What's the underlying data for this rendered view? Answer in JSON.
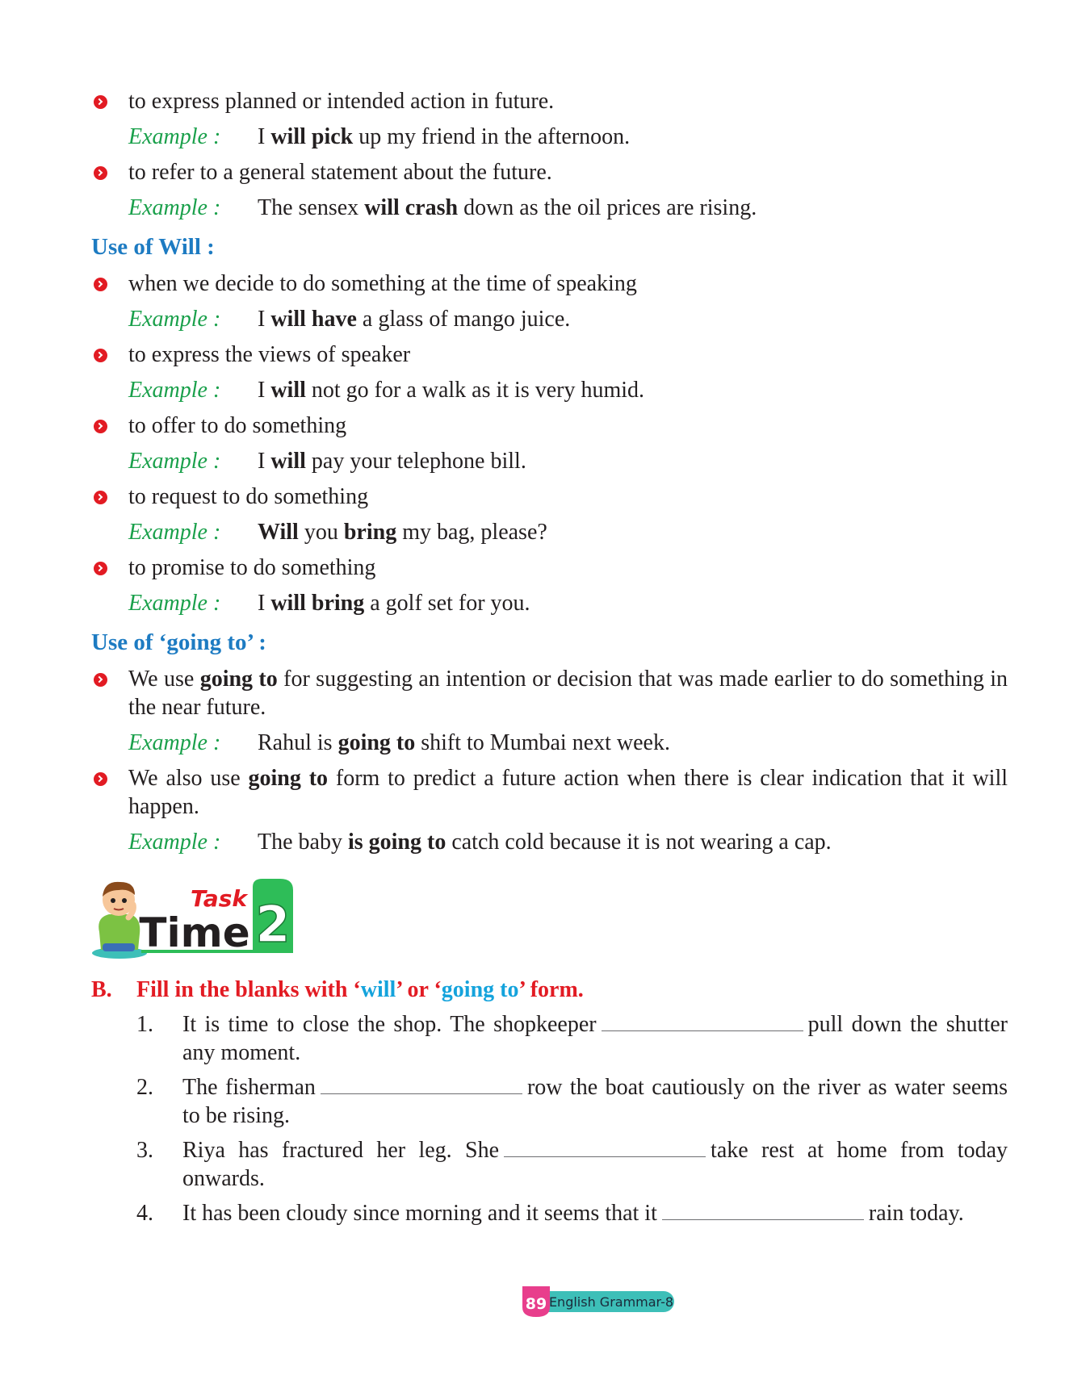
{
  "bullets_intro": [
    {
      "text": "to express planned or intended action in future.",
      "example": {
        "pre": "I ",
        "bold": "will pick",
        "post": " up my friend in the afternoon."
      }
    },
    {
      "text": "to refer to a general statement about the future.",
      "example": {
        "pre": "The sensex ",
        "bold": "will crash",
        "post": " down as the oil prices are rising."
      }
    }
  ],
  "example_label": "Example :",
  "will_section": {
    "heading": "Use of Will :",
    "items": [
      {
        "text": "when we decide to do something at the time of speaking",
        "example": {
          "pre": "I ",
          "bold": "will have",
          "post": " a glass of mango juice."
        }
      },
      {
        "text": "to express the views of speaker",
        "example": {
          "pre": "I ",
          "bold": "will",
          "post": " not go for a walk as it is very humid."
        }
      },
      {
        "text": "to offer to do something",
        "example": {
          "pre": "I ",
          "bold": "will",
          "post": " pay your telephone bill."
        }
      },
      {
        "text": "to request to do something",
        "example": {
          "b1": "Will",
          "mid": " you ",
          "b2": "bring",
          "post": " my bag, please?"
        }
      },
      {
        "text": "to promise to do something",
        "example": {
          "pre": "I ",
          "bold": "will bring",
          "post": " a golf set for you."
        }
      }
    ]
  },
  "going_section": {
    "heading": "Use of ‘going to’ :",
    "items": [
      {
        "pre": "We use ",
        "bold": "going to",
        "post": " for suggesting an intention or decision that was made earlier to do something in the near future.",
        "example": {
          "pre": "Rahul is ",
          "bold": "going to",
          "post": " shift to Mumbai next week."
        }
      },
      {
        "pre": "We also use ",
        "bold": "going to",
        "post": " form to predict a future action when there is clear indication that it will happen.",
        "example": {
          "pre": "The baby ",
          "bold": "is going to",
          "post": " catch cold because it is not wearing a cap."
        }
      }
    ]
  },
  "task_badge": {
    "word1": "Task",
    "word2": "Time",
    "number": "2"
  },
  "exercise": {
    "letter": "B.",
    "title_pre": "Fill in the blanks with ‘",
    "title_will": "will",
    "title_mid": "’ or ‘",
    "title_going": "going to",
    "title_post": "’ form.",
    "questions": [
      {
        "num": "1.",
        "pre": "It is time to close the shop. The shopkeeper",
        "post": "pull down the shutter any moment."
      },
      {
        "num": "2.",
        "pre": "The fisherman",
        "post": "row the boat cautiously on the river as water seems to be rising."
      },
      {
        "num": "3.",
        "pre": "Riya has fractured her leg. She",
        "post": "take rest at home from today onwards."
      },
      {
        "num": "4.",
        "pre": "It has been cloudy since morning and it seems that it",
        "post": "rain today."
      }
    ]
  },
  "footer": {
    "page_number": "89",
    "book_title": "English Grammar-8"
  },
  "colors": {
    "red": "#e21b23",
    "green": "#1aa04b",
    "blue": "#1d7bc2",
    "cyan": "#14a3dc",
    "teal": "#3dbfb8",
    "pink": "#e83e8c"
  }
}
